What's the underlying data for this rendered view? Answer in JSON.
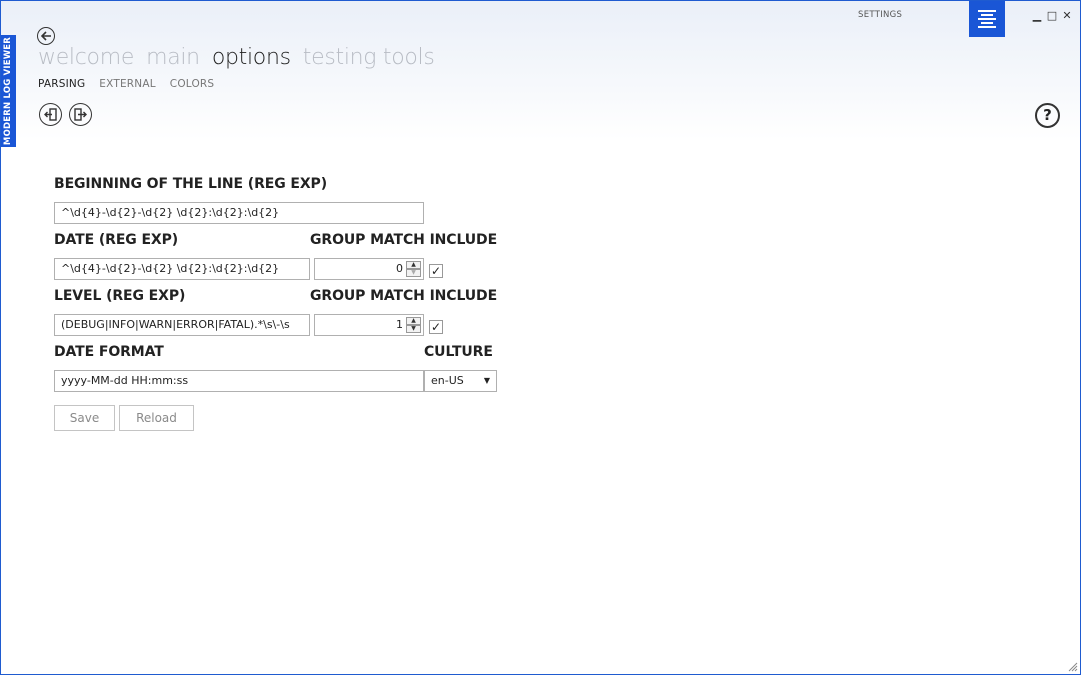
{
  "window": {
    "side_title": "MODERN LOG VIEWER",
    "settings_label": "SETTINGS",
    "minimize": "▁",
    "maximize": "□",
    "close": "✕"
  },
  "nav": {
    "items": [
      {
        "label": "welcome",
        "active": false
      },
      {
        "label": "main",
        "active": false
      },
      {
        "label": "options",
        "active": true
      },
      {
        "label": "testing tools",
        "active": false
      }
    ]
  },
  "subnav": {
    "items": [
      {
        "label": "PARSING",
        "active": true
      },
      {
        "label": "EXTERNAL",
        "active": false
      },
      {
        "label": "COLORS",
        "active": false
      }
    ]
  },
  "icons": {
    "back": "arrow-left-icon",
    "import": "import-icon",
    "export": "export-icon",
    "help": "?",
    "menu": "hamburger-menu-icon"
  },
  "form": {
    "beginning_label": "BEGINNING OF THE LINE (REG EXP)",
    "beginning_value": "^\\d{4}-\\d{2}-\\d{2} \\d{2}:\\d{2}:\\d{2}",
    "date_label": "DATE (REG EXP)",
    "date_value": "^\\d{4}-\\d{2}-\\d{2} \\d{2}:\\d{2}:\\d{2}",
    "date_group_label": "GROUP MATCH INCLUDE",
    "date_group_value": "0",
    "date_include_checked": "✓",
    "level_label": "LEVEL (REG EXP)",
    "level_value": "(DEBUG|INFO|WARN|ERROR|FATAL).*\\s\\-\\s",
    "level_group_label": "GROUP MATCH INCLUDE",
    "level_group_value": "1",
    "level_include_checked": "✓",
    "date_format_label": "DATE FORMAT",
    "date_format_value": "yyyy-MM-dd HH:mm:ss",
    "culture_label": "CULTURE",
    "culture_value": "en-US",
    "save_label": "Save",
    "reload_label": "Reload"
  },
  "colors": {
    "accent": "#1a56d6"
  }
}
